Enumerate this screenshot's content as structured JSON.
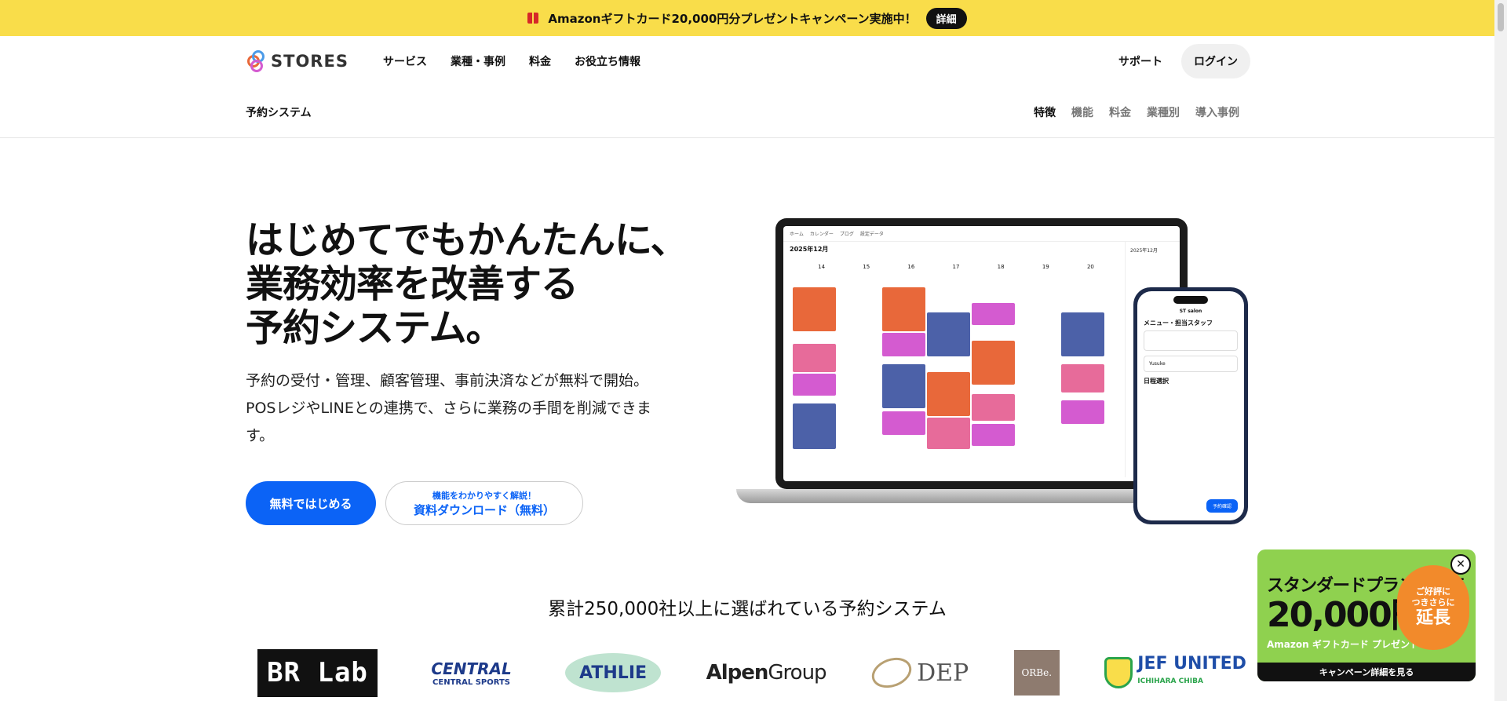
{
  "banner": {
    "text": "Amazonギフトカード20,000円分プレゼントキャンペーン実施中！",
    "detail_label": "詳細"
  },
  "header": {
    "logo_text": "STORES",
    "nav": [
      "サービス",
      "業種・事例",
      "料金",
      "お役立ち情報"
    ],
    "support_label": "サポート",
    "login_label": "ログイン"
  },
  "subnav": {
    "title": "予約システム",
    "links": [
      "特徴",
      "機能",
      "料金",
      "業種別",
      "導入事例"
    ],
    "active": "特徴"
  },
  "hero": {
    "title_lines": [
      "はじめてでもかんたんに、",
      "業務効率を改善する",
      "予約システム。"
    ],
    "desc_lines": [
      "予約の受付・管理、顧客管理、事前決済などが無料で開始。",
      "POSレジやLINEとの連携で、さらに業務の手間を削減できま",
      "す。"
    ],
    "primary_button": "無料ではじめる",
    "secondary_small": "機能をわかりやすく解説！",
    "secondary_big": "資料ダウンロード（無料）"
  },
  "mock": {
    "tabs": [
      "ホーム",
      "カレンダー",
      "ブログ",
      "設定データ"
    ],
    "month": "2025年12月",
    "days": [
      "14",
      "15",
      "16",
      "17",
      "18",
      "19",
      "20"
    ],
    "phone_shop": "ST salon",
    "phone_step1": "メニュー・担当スタッフ",
    "phone_step2": "日程選択",
    "phone_staff": "Yusuke",
    "phone_button": "予約確認",
    "colors": {
      "orange": "#e8683a",
      "pink": "#e76b9a",
      "magenta": "#d45bd0",
      "blue": "#4c61a8"
    }
  },
  "stat_text": "累計250,000社以上に選ばれている予約システム",
  "logos": {
    "brlab": "BR Lab",
    "central": "CENTRAL",
    "central_sub": "CENTRAL SPORTS",
    "athlie": "ATHLIE",
    "alpen_a": "Alpen",
    "alpen_b": "Group",
    "dep": "DEP",
    "orbe": "ORBe.",
    "jef": "JEF UNITED",
    "jef_sub": "ICHIHARA CHIBA"
  },
  "promo": {
    "line1": "スタンダードプラン導入で",
    "line2": "20,000円分",
    "line3": "Amazon ギフトカード プレゼント",
    "badge_top": "ご好評に",
    "badge_mid": "つきさらに",
    "badge_ext": "延長",
    "footer": "キャンペーン詳細を見る"
  },
  "accent": "#0b63f6",
  "banner_color": "#f9dd4a"
}
